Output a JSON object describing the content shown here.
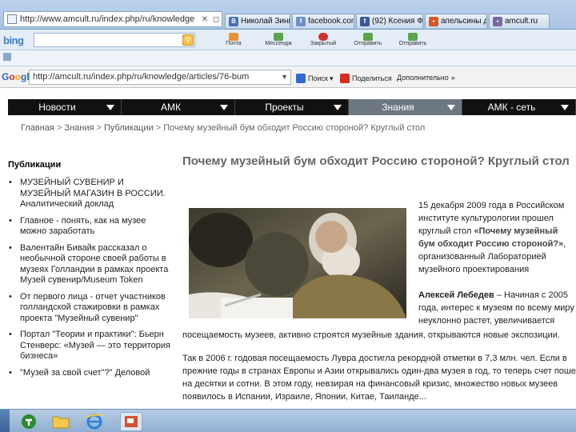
{
  "browser": {
    "address_tab": "http://www.amcult.ru/index.php/ru/knowledge",
    "tabs": [
      {
        "label": "Николай Зинн...",
        "color": "#4a6fb0"
      },
      {
        "label": "facebook.com",
        "color": "#6d8fc9"
      },
      {
        "label": "(92) Ксения Ф...",
        "color": "#3b5998"
      },
      {
        "label": "апельсины дл...",
        "color": "#d45a2a"
      },
      {
        "label": "amcult.ru",
        "color": "#7a6aa0"
      }
    ]
  },
  "bing_toolbar": {
    "logo": "bing",
    "buttons": [
      "Почта",
      "Мессендж",
      "Закрытый",
      "Отправить",
      "Отправить"
    ]
  },
  "google_toolbar": {
    "logo": "Google",
    "url": "http://amcult.ru/index.php/ru/knowledge/articles/76-bum",
    "search_label": "Поиск",
    "share_label": "Поделиться",
    "more_label": "Дополнительно"
  },
  "site": {
    "nav": [
      {
        "label": "Новости",
        "active": false
      },
      {
        "label": "АМК",
        "active": false
      },
      {
        "label": "Проекты",
        "active": false
      },
      {
        "label": "Знания",
        "active": true
      },
      {
        "label": "АМК - сеть",
        "active": false
      }
    ],
    "breadcrumb": [
      "Главная",
      "Знания",
      "Публикации",
      "Почему музейный бум обходит Россию стороной? Круглый стол"
    ],
    "sidebar": {
      "title": "Публикации",
      "items": [
        "МУЗЕЙНЫЙ СУВЕНИР И МУЗЕЙНЫЙ МАГАЗИН В РОССИИ. Аналитический доклад",
        "Главное - понять, как на музее можно заработать",
        "Валентайн Бивайк рассказал о необычной стороне своей работы в музеях Голландии в рамках проекта Музей сувенир/Museum Token",
        "От первого лица - отчет участников голландской стажировки в рамках проекта \"Музейный сувенир\"",
        "Портал \"Теории и практики\": Бьерн Стенверс: «Музей — это территория бизнеса»",
        "\"Музей за свой счет\"?\" Деловой"
      ]
    },
    "article": {
      "title": "Почему музейный бум обходит Россию стороной? Круглый стол",
      "intro_plain": "15 декабря 2009 года в Российском институте культурологии прошел круглый стол ",
      "intro_bold": "«Почему музейный бум обходит Россию стороной?»",
      "intro_tail": ", организованный Лабораторией музейного проектирования",
      "author": "Алексей Лебедев",
      "author_text": " – Начиная с 2005 года, интерес к музеям по всему миру неуклонно растет, увеличивается",
      "body_lines": [
        "посещаемость музеев, активно строятся музейные здания, открываются новые экспозиции.",
        "Так в 2006 г. годовая посещаемость Лувра достигла рекордной отметки в 7,3 млн. чел. Если в",
        "прежние годы в странах Европы и Азии открывались один-два музея в год, то теперь счет пошел",
        "на десятки и сотни. В этом году, невзирая на финансовый кризис, множество новых музеев",
        "появилось в Испании, Израиле, Японии, Китае, Таиланде..."
      ]
    }
  },
  "colors": {
    "nav_bg": "#111111",
    "nav_active": "#6c7781",
    "title": "#666666"
  }
}
